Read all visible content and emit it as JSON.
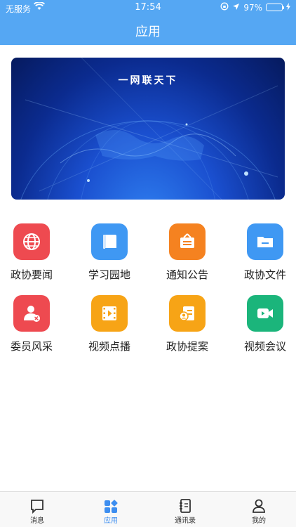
{
  "status_bar": {
    "carrier": "无服务",
    "time": "17:54",
    "battery": "97%",
    "battery_level": 0.97
  },
  "header": {
    "title": "应用"
  },
  "banner": {
    "text": "一网联天下"
  },
  "apps": [
    {
      "label": "政协要闻",
      "icon": "globe-icon",
      "color": "#ee4a50"
    },
    {
      "label": "学习园地",
      "icon": "book-icon",
      "color": "#3f98f3"
    },
    {
      "label": "通知公告",
      "icon": "notice-board-icon",
      "color": "#f58220"
    },
    {
      "label": "政协文件",
      "icon": "folder-icon",
      "color": "#3f98f3"
    },
    {
      "label": "委员风采",
      "icon": "member-icon",
      "color": "#ee4a50"
    },
    {
      "label": "视频点播",
      "icon": "film-icon",
      "color": "#f7a416"
    },
    {
      "label": "政协提案",
      "icon": "proposal-icon",
      "color": "#f7a416"
    },
    {
      "label": "视频会议",
      "icon": "video-camera-icon",
      "color": "#1bb57b"
    }
  ],
  "tabbar": {
    "items": [
      {
        "label": "消息",
        "icon": "message-icon"
      },
      {
        "label": "应用",
        "icon": "apps-icon",
        "active": true
      },
      {
        "label": "通讯录",
        "icon": "contacts-icon"
      },
      {
        "label": "我的",
        "icon": "profile-icon"
      }
    ],
    "active_color": "#3d8ef0"
  }
}
